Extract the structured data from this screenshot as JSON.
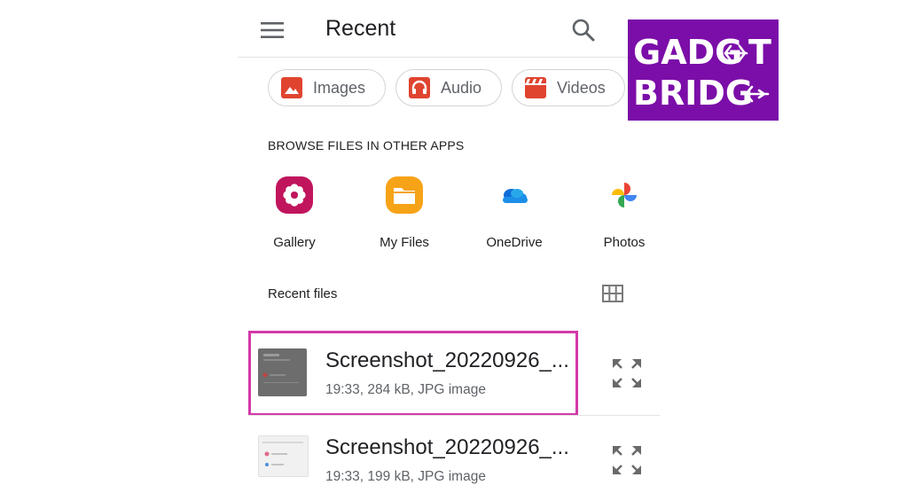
{
  "header": {
    "title": "Recent",
    "menu_icon": "menu-icon",
    "search_icon": "search-icon"
  },
  "chips": [
    {
      "label": "Images",
      "icon": "image-icon"
    },
    {
      "label": "Audio",
      "icon": "headphones-icon"
    },
    {
      "label": "Videos",
      "icon": "clapperboard-icon"
    }
  ],
  "browse": {
    "heading": "BROWSE FILES IN OTHER APPS",
    "apps": [
      {
        "label": "Gallery",
        "icon": "gallery-icon"
      },
      {
        "label": "My Files",
        "icon": "folder-icon"
      },
      {
        "label": "OneDrive",
        "icon": "onedrive-icon"
      },
      {
        "label": "Photos",
        "icon": "photos-pinwheel-icon"
      }
    ]
  },
  "recent_files": {
    "heading": "Recent files",
    "view_toggle_icon": "grid-view-icon",
    "items": [
      {
        "name": "Screenshot_20220926_...",
        "meta": "19:33, 284 kB, JPG image",
        "action_icon": "expand-icon"
      },
      {
        "name": "Screenshot_20220926_...",
        "meta": "19:33, 199 kB, JPG image",
        "action_icon": "expand-icon"
      }
    ]
  },
  "watermark": {
    "line1": "GADG",
    "line1_end": "T",
    "line2": "BRIDG",
    "color": "#7b0ea8"
  },
  "colors": {
    "highlight": "#d23aa9",
    "chip_icon": "#e0442f"
  }
}
